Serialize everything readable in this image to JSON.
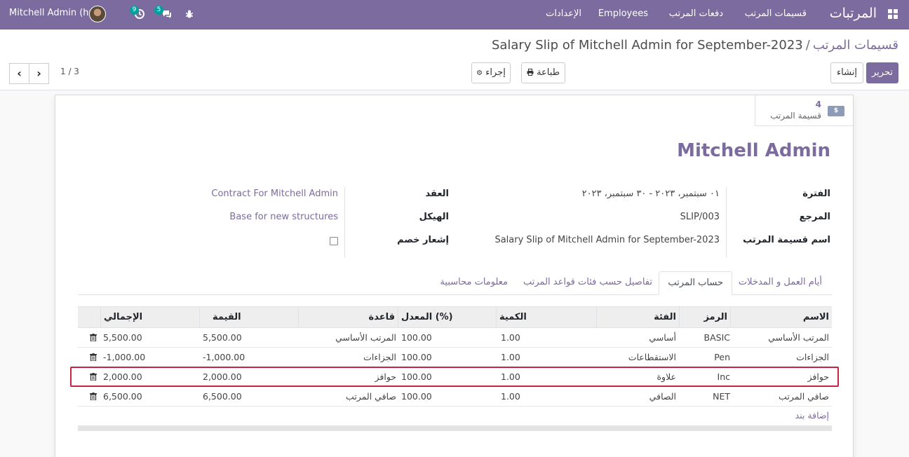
{
  "navbar": {
    "brand": "المرتبات",
    "menu": [
      "قسيمات المرتب",
      "دفعات المرتب",
      "Employees",
      "الإعدادات"
    ],
    "user_name": "Mitchell Admin (hr)",
    "activity_count": "9",
    "messages_count": "5"
  },
  "breadcrumb": {
    "parent": "قسيمات المرتب",
    "separator": "/",
    "current": "Salary Slip of Mitchell Admin for September-2023"
  },
  "actions": {
    "edit": "تحرير",
    "create": "إنشاء",
    "print": "طباعة",
    "action": "إجراء"
  },
  "pager": {
    "value": "1 / 3"
  },
  "stat_button": {
    "value": "4",
    "label": "قسيمة المرتب"
  },
  "record": {
    "employee": "Mitchell Admin",
    "period_label": "الفترة",
    "period_value": "٠١ سبتمبر، ٢٠٢٣ - ٣٠ سبتمبر، ٢٠٢٣",
    "reference_label": "المرجع",
    "reference_value": "SLIP/003",
    "slip_name_label": "اسم قسيمة المرتب",
    "slip_name_value": "Salary Slip of Mitchell Admin for September-2023",
    "contract_label": "العقد",
    "contract_value": "Contract For Mitchell Admin",
    "structure_label": "الهيكل",
    "structure_value": "Base for new structures",
    "credit_note_label": "إشعار خصم",
    "credit_note_checked": false
  },
  "tabs": [
    "أيام العمل و المدخلات",
    "حساب المرتب",
    "تفاصيل حسب فئات قواعد المرتب",
    "معلومات محاسبية"
  ],
  "active_tab": 1,
  "table": {
    "headers": {
      "name": "الاسم",
      "code": "الرمز",
      "category": "الفئة",
      "quantity": "الكمية",
      "rate": "المعدل (%)",
      "rule": "قاعدة",
      "amount": "القيمة",
      "total": "الإجمالي"
    },
    "rows": [
      {
        "name": "المرتب الأساسي",
        "code": "BASIC",
        "category": "أساسي",
        "quantity": "1.00",
        "rate": "100.00",
        "rule": "المرتب الأساسي",
        "amount": "5,500.00",
        "total": "5,500.00"
      },
      {
        "name": "الجزاءات",
        "code": "Pen",
        "category": "الاستقطاعات",
        "quantity": "1.00",
        "rate": "100.00",
        "rule": "الجزاءات",
        "amount": "-1,000.00",
        "total": "-1,000.00"
      },
      {
        "name": "حوافز",
        "code": "Inc",
        "category": "علاوة",
        "quantity": "1.00",
        "rate": "100.00",
        "rule": "حوافز",
        "amount": "2,000.00",
        "total": "2,000.00"
      },
      {
        "name": "صافي المرتب",
        "code": "NET",
        "category": "الصافي",
        "quantity": "1.00",
        "rate": "100.00",
        "rule": "صافي المرتب",
        "amount": "6,500.00",
        "total": "6,500.00"
      }
    ],
    "add_line": "إضافة بند"
  },
  "colors": {
    "brand": "#7c6b9e",
    "badge": "#00a09d",
    "highlight": "#c9243f"
  }
}
